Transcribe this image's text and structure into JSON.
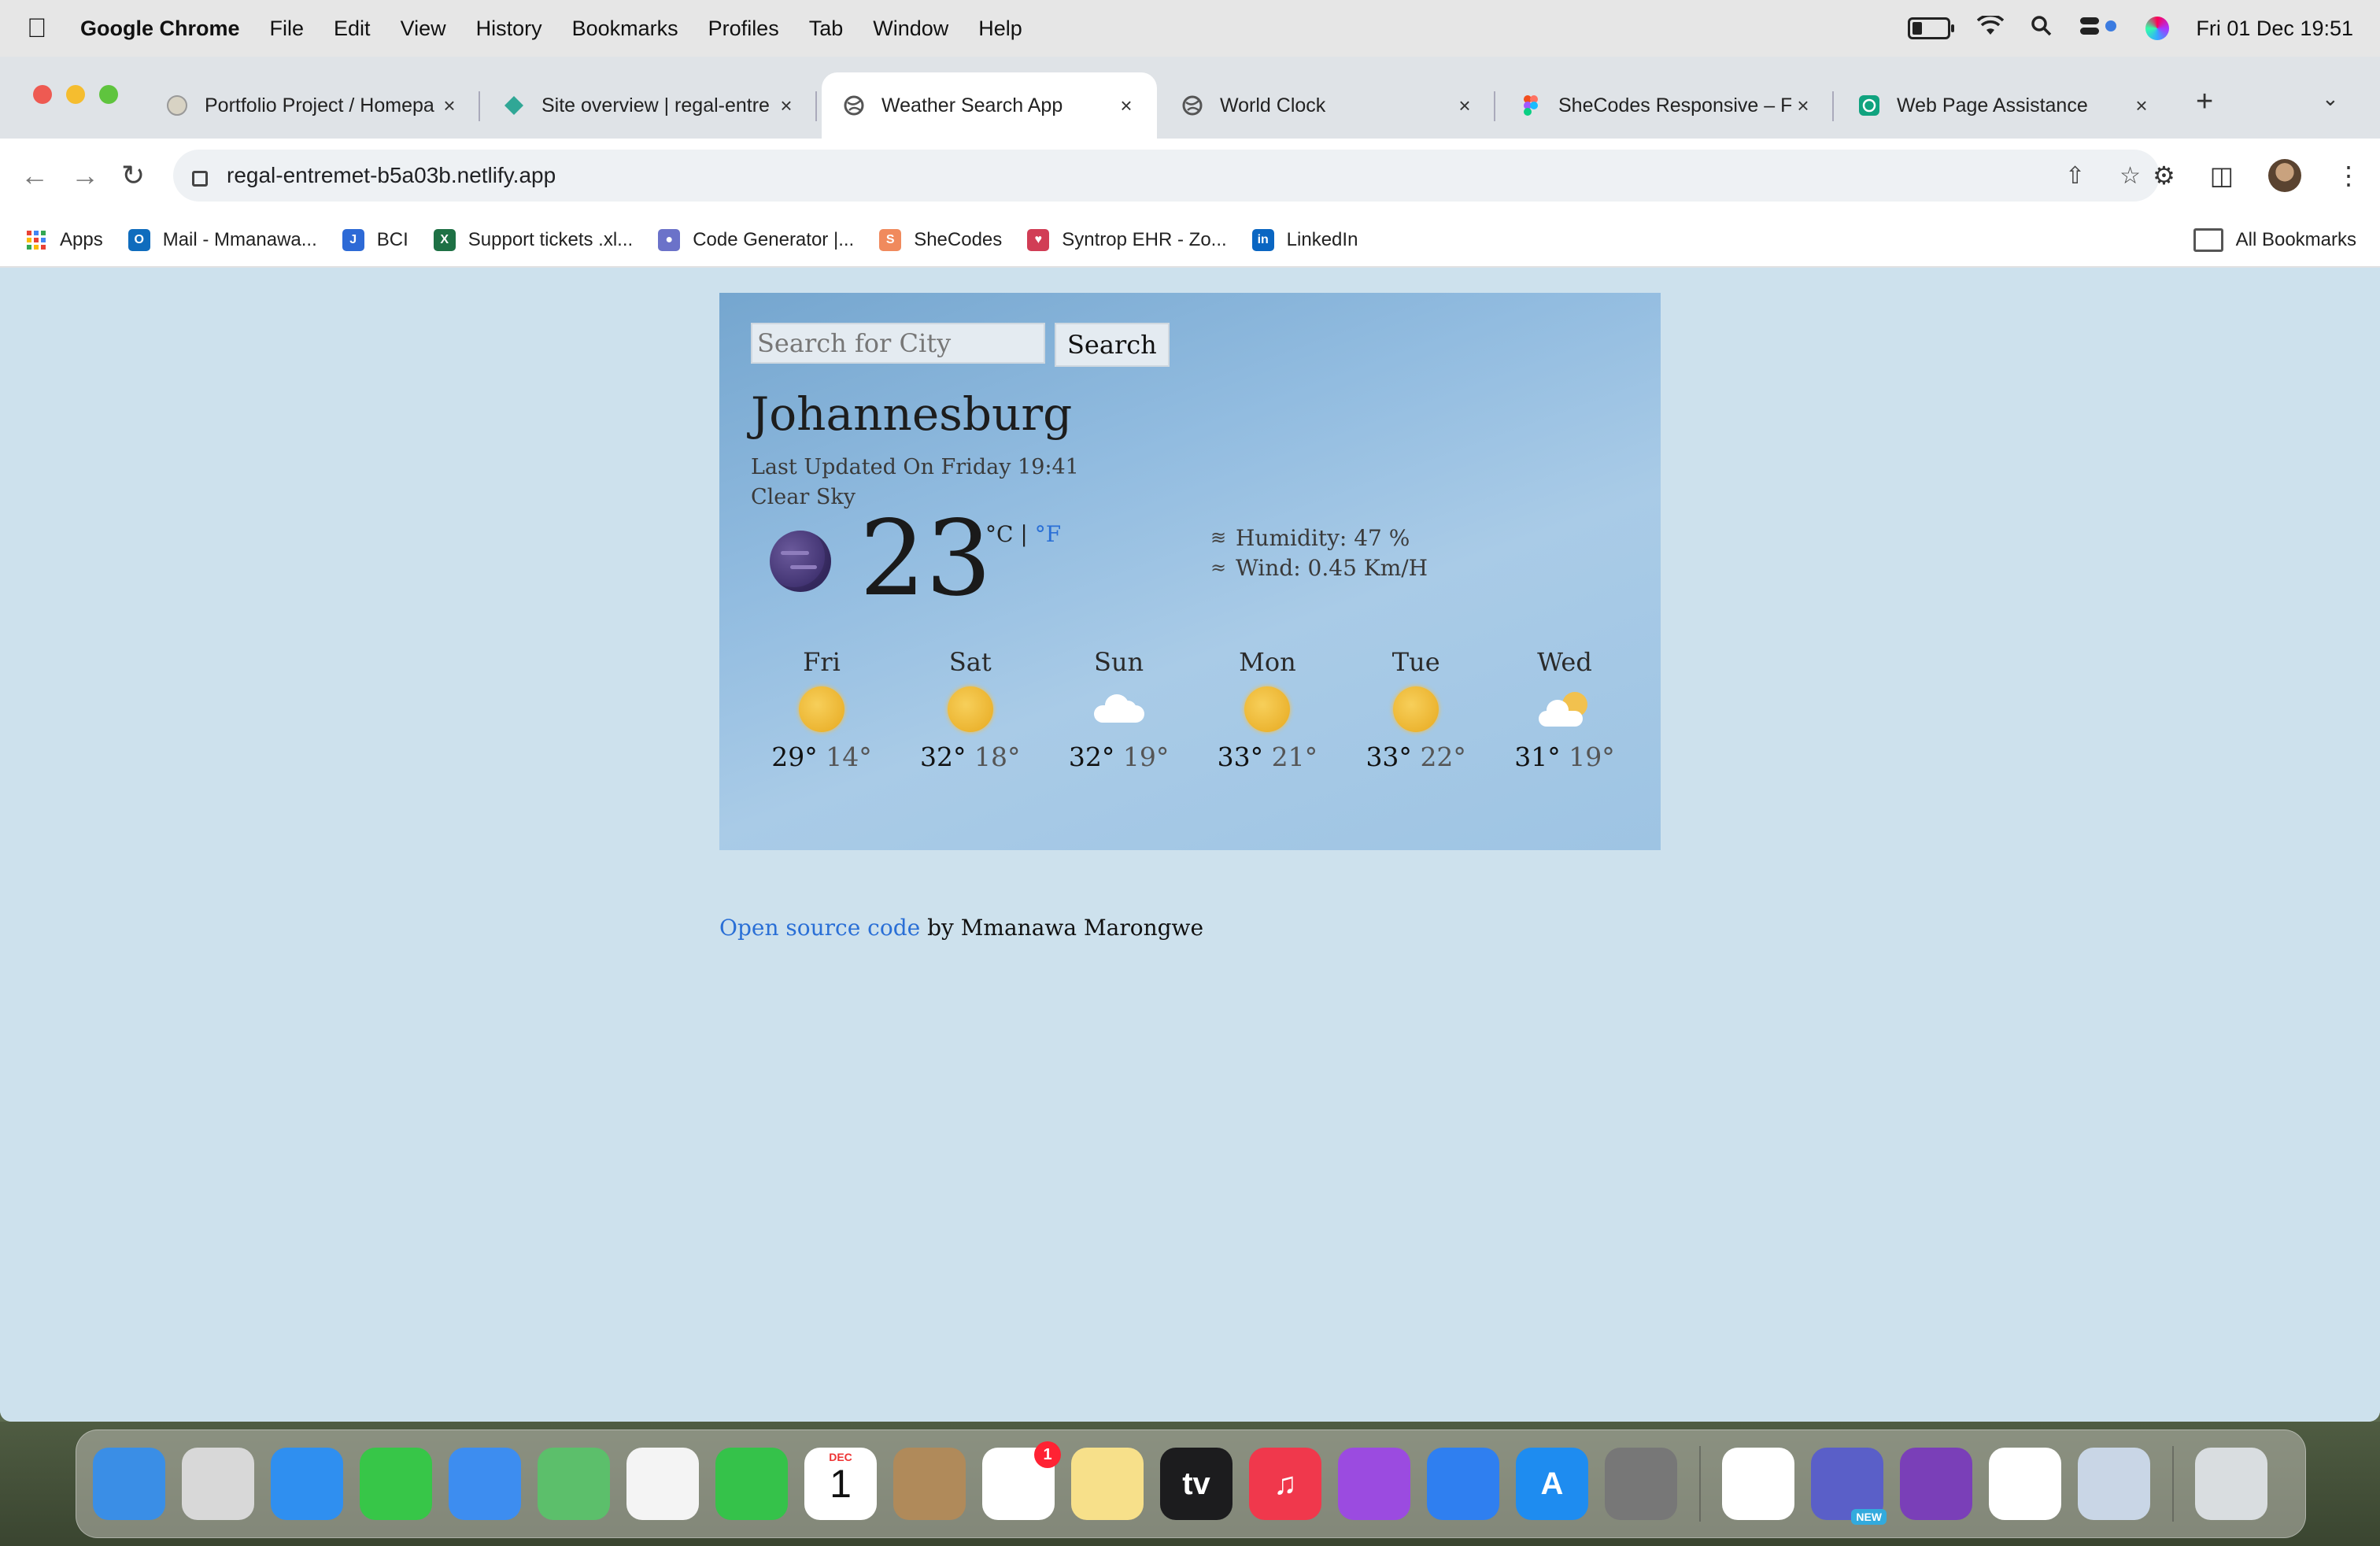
{
  "menubar": {
    "app_name": "Google Chrome",
    "menus": [
      "File",
      "Edit",
      "View",
      "History",
      "Bookmarks",
      "Profiles",
      "Tab",
      "Window",
      "Help"
    ],
    "datetime": "Fri 01 Dec  19:51"
  },
  "tabs": [
    {
      "title": "Portfolio Project / Homepa",
      "icon": "portfolio-favicon"
    },
    {
      "title": "Site overview | regal-entre",
      "icon": "netlify-favicon"
    },
    {
      "title": "Weather Search App",
      "icon": "globe-favicon",
      "active": true
    },
    {
      "title": "World Clock",
      "icon": "globe-favicon"
    },
    {
      "title": "SheCodes Responsive – F",
      "icon": "figma-favicon"
    },
    {
      "title": "Web Page Assistance",
      "icon": "chatgpt-favicon"
    }
  ],
  "tab_close_glyph": "×",
  "address_bar": {
    "url": "regal-entremet-b5a03b.netlify.app"
  },
  "bookmarks": {
    "items": [
      {
        "label": "Apps",
        "color": "#e94235"
      },
      {
        "label": "Mail - Mmanawa...",
        "color": "#0f6cbd"
      },
      {
        "label": "BCI",
        "color": "#2d6ad6"
      },
      {
        "label": "Support tickets .xl...",
        "color": "#1e7145"
      },
      {
        "label": "Code Generator |...",
        "color": "#6b72c9"
      },
      {
        "label": "SheCodes",
        "color": "#f08a5d"
      },
      {
        "label": "Syntrop EHR - Zo...",
        "color": "#d13d55"
      },
      {
        "label": "LinkedIn",
        "color": "#0a66c2"
      }
    ],
    "all_label": "All Bookmarks"
  },
  "weather": {
    "search_placeholder": "Search for City",
    "search_button": "Search",
    "city": "Johannesburg",
    "last_updated": "Last Updated On Friday 19:41",
    "description": "Clear Sky",
    "temperature": "23",
    "unit_c": "°C",
    "unit_sep": "|",
    "unit_f": "°F",
    "humidity": "Humidity: 47 %",
    "wind": "Wind: 0.45 Km/H",
    "forecast": [
      {
        "day": "Fri",
        "max": "29°",
        "min": "14°",
        "icon": "sun"
      },
      {
        "day": "Sat",
        "max": "32°",
        "min": "18°",
        "icon": "sun"
      },
      {
        "day": "Sun",
        "max": "32°",
        "min": "19°",
        "icon": "cloud"
      },
      {
        "day": "Mon",
        "max": "33°",
        "min": "21°",
        "icon": "sun"
      },
      {
        "day": "Tue",
        "max": "33°",
        "min": "22°",
        "icon": "sun"
      },
      {
        "day": "Wed",
        "max": "31°",
        "min": "19°",
        "icon": "partly-cloudy"
      }
    ]
  },
  "credit": {
    "link": "Open source code",
    "text": " by Mmanawa Marongwe"
  },
  "dock": {
    "apps": [
      {
        "name": "finder",
        "color": "#3a8ee6"
      },
      {
        "name": "launchpad",
        "color": "#d8d8d8"
      },
      {
        "name": "safari",
        "color": "#2f8ff0"
      },
      {
        "name": "messages",
        "color": "#37c648"
      },
      {
        "name": "mail",
        "color": "#3d8df0"
      },
      {
        "name": "maps",
        "color": "#5cbf6b"
      },
      {
        "name": "photos",
        "color": "#f4f4f4"
      },
      {
        "name": "facetime",
        "color": "#35c24a"
      },
      {
        "name": "calendar",
        "color": "#ffffff",
        "text": "1",
        "subtext": "DEC"
      },
      {
        "name": "contacts",
        "color": "#b08a5a"
      },
      {
        "name": "reminders",
        "color": "#ffffff",
        "badge": "1"
      },
      {
        "name": "notes",
        "color": "#f7e08a"
      },
      {
        "name": "apple-tv",
        "color": "#1c1c1e",
        "text": "tv"
      },
      {
        "name": "music",
        "color": "#f0384c",
        "text": "♫"
      },
      {
        "name": "podcasts",
        "color": "#9b4be0"
      },
      {
        "name": "keynote",
        "color": "#2f7ff0"
      },
      {
        "name": "app-store",
        "color": "#1e8cf0",
        "text": "A"
      },
      {
        "name": "system-settings",
        "color": "#777777"
      }
    ],
    "recent": [
      {
        "name": "chrome",
        "color": "#ffffff"
      },
      {
        "name": "teams",
        "color": "#5a5fc8",
        "badge_text": "NEW"
      },
      {
        "name": "github-desktop",
        "color": "#7a3fb8"
      },
      {
        "name": "vscode",
        "color": "#ffffff"
      },
      {
        "name": "preview",
        "color": "#c9d6e6"
      }
    ],
    "trash": {
      "name": "trash",
      "color": "#d9dde0"
    }
  }
}
